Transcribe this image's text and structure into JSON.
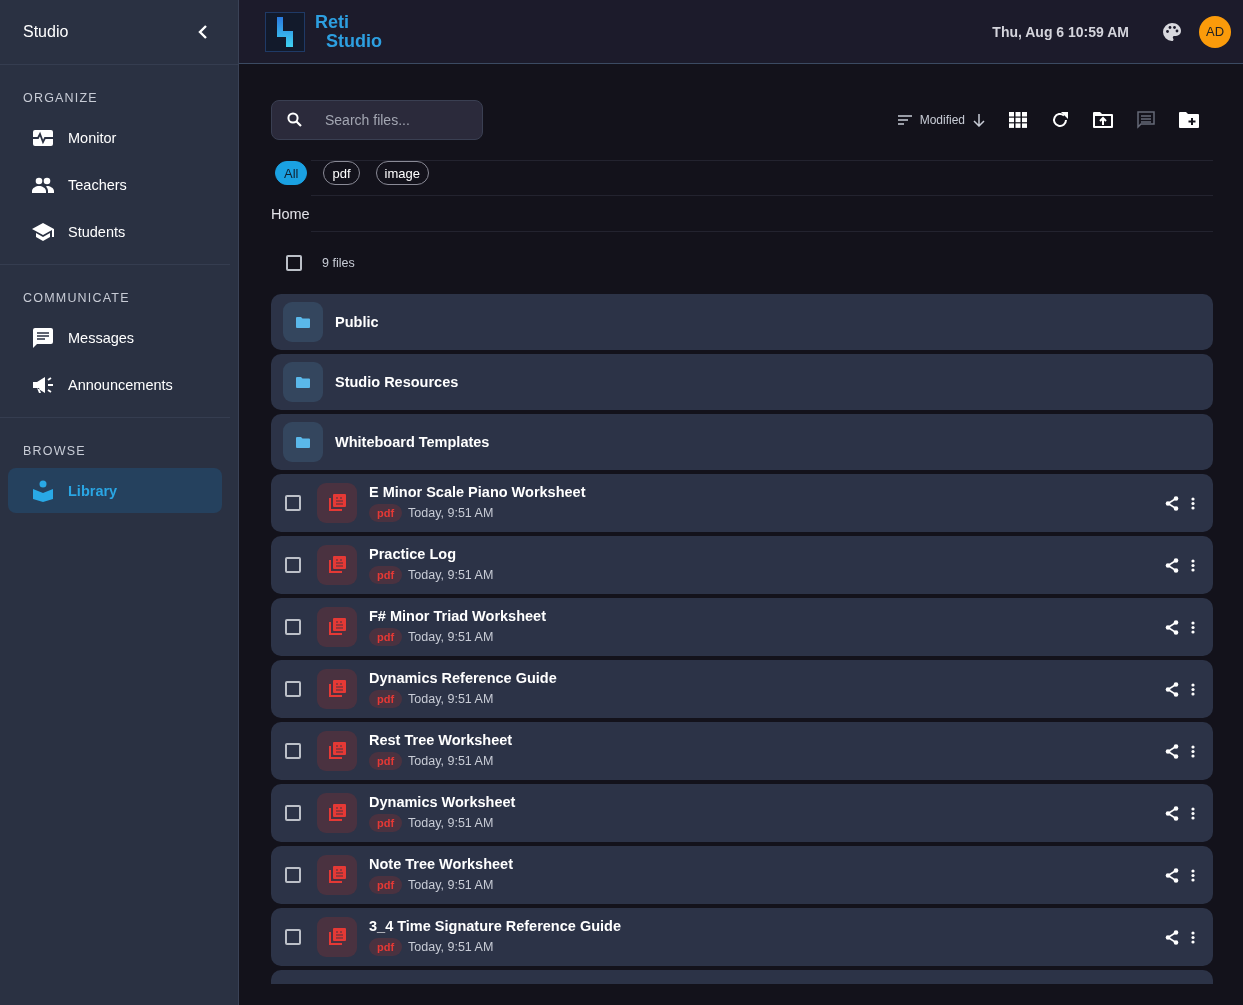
{
  "sidebar": {
    "title": "Studio",
    "sections": [
      {
        "heading": "ORGANIZE",
        "items": [
          {
            "label": "Monitor",
            "selected": false
          },
          {
            "label": "Teachers",
            "selected": false
          },
          {
            "label": "Students",
            "selected": false
          }
        ]
      },
      {
        "heading": "COMMUNICATE",
        "items": [
          {
            "label": "Messages",
            "selected": false
          },
          {
            "label": "Announcements",
            "selected": false
          }
        ]
      },
      {
        "heading": "BROWSE",
        "items": [
          {
            "label": "Library",
            "selected": true
          }
        ]
      }
    ]
  },
  "header": {
    "logo_lines": [
      "Reti",
      "Studio"
    ],
    "datetime": "Thu, Aug 6 10:59 AM",
    "avatar": "AD"
  },
  "toolbar": {
    "search": {
      "placeholder": "Search files..."
    },
    "sort": {
      "label": "Modified"
    }
  },
  "filters": [
    {
      "label": "All",
      "selected": true
    },
    {
      "label": "pdf",
      "selected": false
    },
    {
      "label": "image",
      "selected": false
    }
  ],
  "breadcrumb": "Home",
  "select_all": {
    "checked": false,
    "label": "9 files"
  },
  "items": [
    {
      "kind": "folder",
      "name": "Public"
    },
    {
      "kind": "folder",
      "name": "Studio Resources"
    },
    {
      "kind": "folder",
      "name": "Whiteboard Templates"
    },
    {
      "kind": "file",
      "name": "E Minor Scale Piano Worksheet",
      "type": "pdf",
      "modified": "Today, 9:51 AM",
      "checked": false
    },
    {
      "kind": "file",
      "name": "Practice Log",
      "type": "pdf",
      "modified": "Today, 9:51 AM",
      "checked": false
    },
    {
      "kind": "file",
      "name": "F# Minor Triad Worksheet",
      "type": "pdf",
      "modified": "Today, 9:51 AM",
      "checked": false
    },
    {
      "kind": "file",
      "name": "Dynamics Reference Guide",
      "type": "pdf",
      "modified": "Today, 9:51 AM",
      "checked": false
    },
    {
      "kind": "file",
      "name": "Rest Tree Worksheet",
      "type": "pdf",
      "modified": "Today, 9:51 AM",
      "checked": false
    },
    {
      "kind": "file",
      "name": "Dynamics Worksheet",
      "type": "pdf",
      "modified": "Today, 9:51 AM",
      "checked": false
    },
    {
      "kind": "file",
      "name": "Note Tree Worksheet",
      "type": "pdf",
      "modified": "Today, 9:51 AM",
      "checked": false
    },
    {
      "kind": "file",
      "name": "3_4 Time Signature Reference Guide",
      "type": "pdf",
      "modified": "Today, 9:51 AM",
      "checked": false
    }
  ]
}
